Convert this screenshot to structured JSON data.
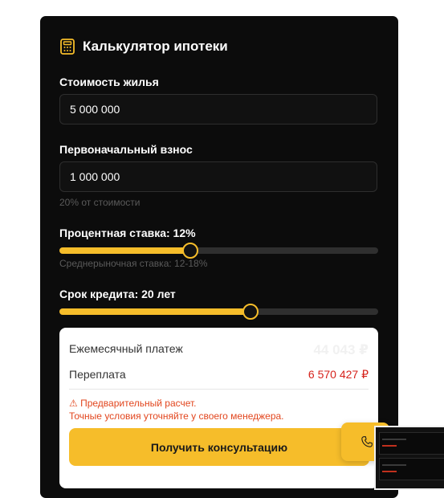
{
  "calculator": {
    "title": "Калькулятор ипотеки",
    "icon": "calculator-icon",
    "price_label": "Стоимость жилья",
    "price_value": "5 000 000",
    "down_label": "Первоначальный взнос",
    "down_value": "1 000 000",
    "down_hint": "20% от стоимости",
    "rate_label": "Процентная ставка: 12%",
    "rate_hint": "Среднерыночная ставка: 12-18%",
    "rate_level": 0.41,
    "term_label": "Срок кредита: 20 лет",
    "term_level": 0.6
  },
  "result": {
    "payment_label": "Ежемесячный платеж",
    "payment_value": "44 043 ₽",
    "overpay_label": "Переплата",
    "overpay_value": "6 570 427 ₽",
    "warning_line1": "⚠ Предварительный расчет.",
    "warning_line2": "Точные условия уточняйте у своего менеджера.",
    "button": "Получить консультацию"
  },
  "colors": {
    "accent": "#f6bd2a",
    "card": "#0c0c0c",
    "warning": "#e2461e",
    "overpay": "#d6231c"
  },
  "fab": {
    "icon": "phone-icon"
  }
}
